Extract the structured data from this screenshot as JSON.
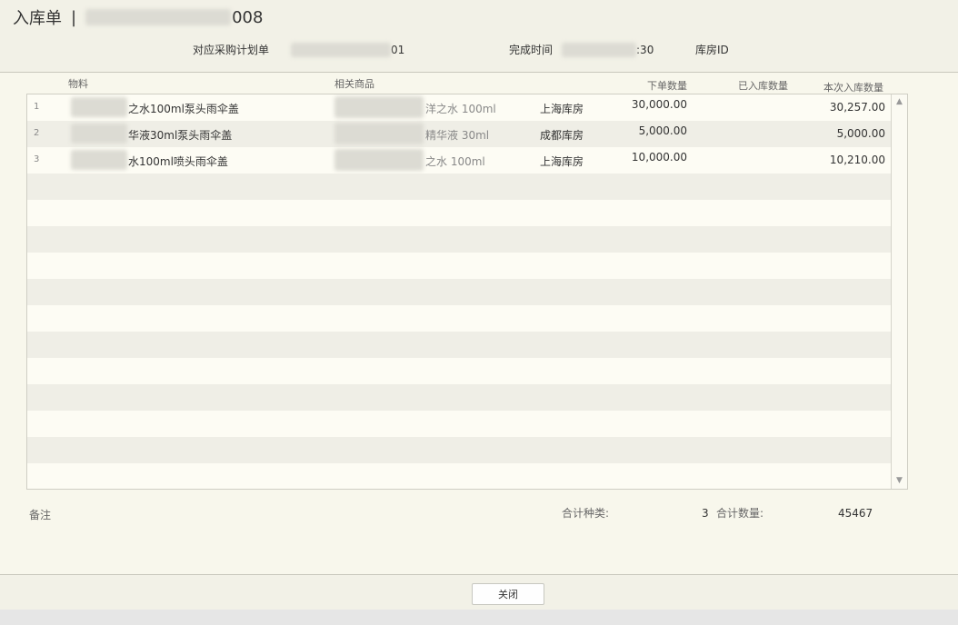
{
  "header": {
    "title_prefix": "入库单",
    "title_separator": "|",
    "title_id_suffix": "008",
    "plan_label": "对应采购计划单",
    "plan_value_suffix": "01",
    "time_label": "完成时间",
    "time_value_suffix": ":30",
    "warehouse_id_label": "库房ID"
  },
  "columns": {
    "material": "物料",
    "product": "相关商品",
    "ordered": "下单数量",
    "received": "已入库数量",
    "this_time": "本次入库数量"
  },
  "rows": [
    {
      "index": "1",
      "material_suffix": "之水100ml泵头雨伞盖",
      "product_suffix": "洋之水 100ml",
      "warehouse": "上海库房",
      "ordered": "30,000.00",
      "received": "",
      "this_time": "30,257.00"
    },
    {
      "index": "2",
      "material_suffix": "华液30ml泵头雨伞盖",
      "product_suffix": "精华液 30ml",
      "warehouse": "成都库房",
      "ordered": "5,000.00",
      "received": "",
      "this_time": "5,000.00"
    },
    {
      "index": "3",
      "material_suffix": "水100ml喷头雨伞盖",
      "product_suffix": "之水 100ml",
      "warehouse": "上海库房",
      "ordered": "10,000.00",
      "received": "",
      "this_time": "10,210.00"
    }
  ],
  "footer": {
    "remark_label": "备注",
    "total_kinds_label": "合计种类:",
    "total_kinds_value": "3",
    "total_qty_label": "合计数量:",
    "total_qty_value": "45467"
  },
  "actions": {
    "close_label": "关闭"
  },
  "scrollbar": {
    "up_glyph": "▲",
    "down_glyph": "▼"
  }
}
